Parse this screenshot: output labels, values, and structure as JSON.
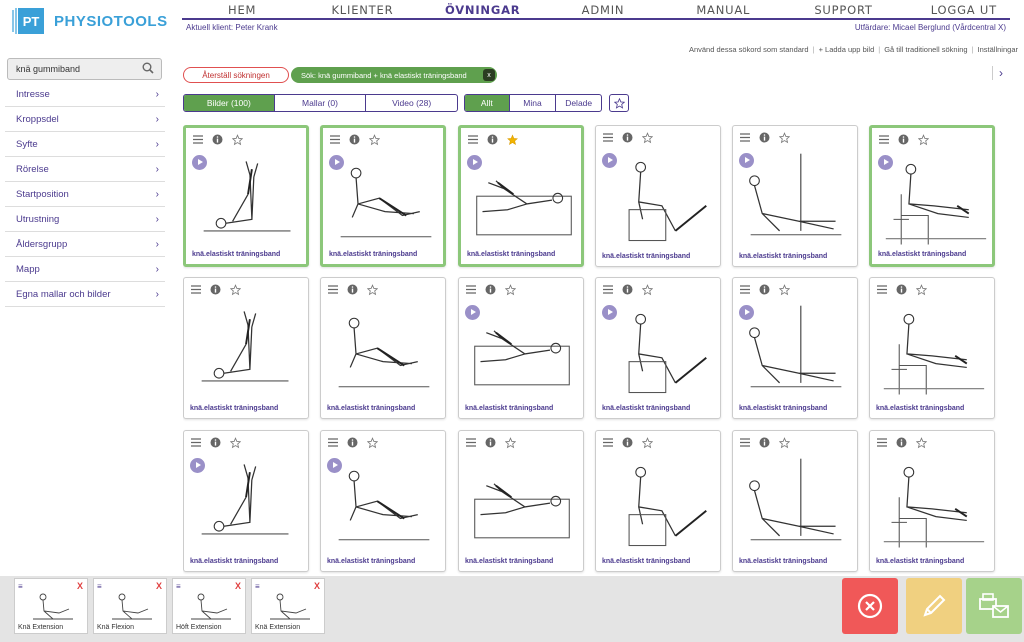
{
  "brand": {
    "logo_letters": "PT",
    "name": "PHYSIOTOOLS"
  },
  "nav": [
    "HEM",
    "KLIENTER",
    "ÖVNINGAR",
    "ADMIN",
    "MANUAL",
    "SUPPORT",
    "LOGGA UT"
  ],
  "nav_active": "ÖVNINGAR",
  "client_label": "Aktuell klient: Peter Krank",
  "issuer_label": "Utfärdare: Micael Berglund (Vårdcentral X)",
  "top_links": [
    "Använd dessa sökord som standard",
    "+ Ladda upp bild",
    "Gå till traditionell sökning",
    "Inställningar"
  ],
  "search": {
    "value": "knä gummiband"
  },
  "filters": [
    "Intresse",
    "Kroppsdel",
    "Syfte",
    "Rörelse",
    "Startposition",
    "Utrustning",
    "Åldersgrupp",
    "Mapp",
    "Egna mallar och bilder"
  ],
  "reset_label": "Återställ sökningen",
  "search_tag": "Sök: knä gummiband + knä elastiskt träningsband",
  "search_tag_close": "x",
  "media_tabs": [
    "Bilder (100)",
    "Mallar (0)",
    "Video (28)"
  ],
  "owner_tabs": [
    "Allt",
    "Mina",
    "Delade"
  ],
  "card_label": "knä.elastiskt träningsband",
  "cards": [
    {
      "selected": true,
      "video": true,
      "starred": false
    },
    {
      "selected": true,
      "video": true,
      "starred": false
    },
    {
      "selected": true,
      "video": true,
      "starred": true
    },
    {
      "selected": false,
      "video": true,
      "starred": false
    },
    {
      "selected": false,
      "video": true,
      "starred": false
    },
    {
      "selected": true,
      "video": true,
      "starred": false
    },
    {
      "selected": false,
      "video": false,
      "starred": false
    },
    {
      "selected": false,
      "video": false,
      "starred": false
    },
    {
      "selected": false,
      "video": true,
      "starred": false
    },
    {
      "selected": false,
      "video": true,
      "starred": false
    },
    {
      "selected": false,
      "video": true,
      "starred": false
    },
    {
      "selected": false,
      "video": false,
      "starred": false
    },
    {
      "selected": false,
      "video": true,
      "starred": false
    },
    {
      "selected": false,
      "video": true,
      "starred": false
    },
    {
      "selected": false,
      "video": false,
      "starred": false
    },
    {
      "selected": false,
      "video": false,
      "starred": false
    },
    {
      "selected": false,
      "video": false,
      "starred": false
    },
    {
      "selected": false,
      "video": false,
      "starred": false
    }
  ],
  "tray": [
    {
      "label": "Knä Extension"
    },
    {
      "label": "Knä Flexion"
    },
    {
      "label": "Höft Extension"
    },
    {
      "label": "Knä Extension"
    }
  ],
  "colors": {
    "brand": "#3aa0d8",
    "accent": "#4b3a8e",
    "green": "#5fa04e",
    "delete": "#f05858",
    "edit": "#f0d080",
    "print": "#a6d28a"
  }
}
